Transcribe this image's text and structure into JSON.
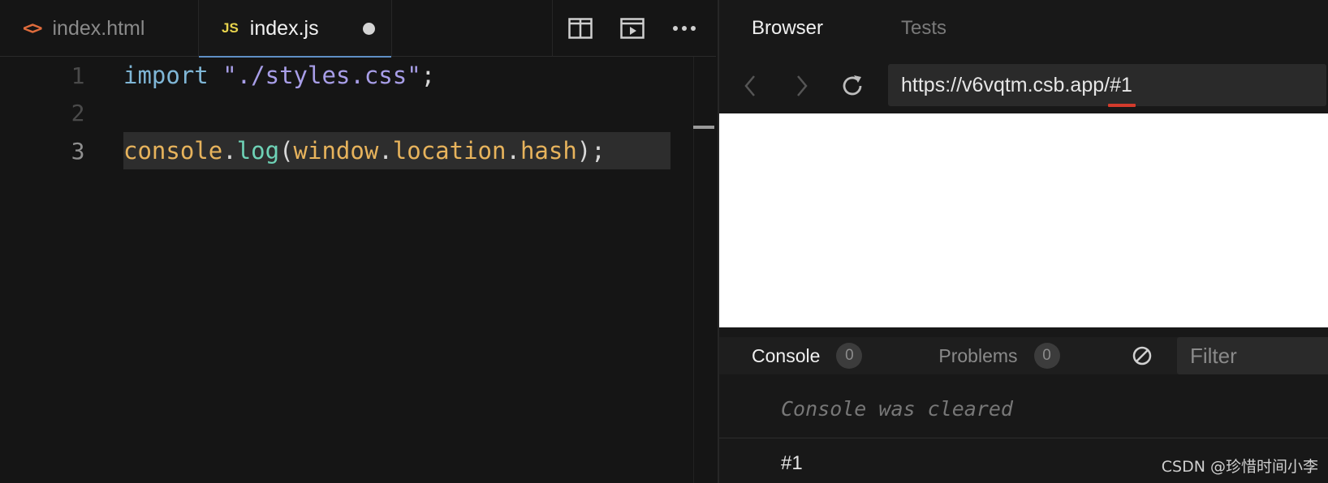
{
  "editor": {
    "tabs": [
      {
        "label": "index.html",
        "icon": "html-code-icon",
        "icon_glyph": "<>",
        "active": false
      },
      {
        "label": "index.js",
        "icon": "js-file-icon",
        "icon_glyph": "JS",
        "active": true,
        "unsaved": true
      }
    ],
    "actions": [
      "split-editor-icon",
      "open-preview-icon",
      "more-actions-icon"
    ],
    "lines": [
      {
        "number": "1",
        "tokens": [
          {
            "t": "import",
            "c": "kw"
          },
          {
            "t": " ",
            "c": "punc"
          },
          {
            "t": "\"./styles.css\"",
            "c": "str"
          },
          {
            "t": ";",
            "c": "punc"
          }
        ]
      },
      {
        "number": "2",
        "tokens": []
      },
      {
        "number": "3",
        "active": true,
        "tokens": [
          {
            "t": "console",
            "c": "ident"
          },
          {
            "t": ".",
            "c": "punc"
          },
          {
            "t": "log",
            "c": "fn"
          },
          {
            "t": "(",
            "c": "punc"
          },
          {
            "t": "window",
            "c": "ident"
          },
          {
            "t": ".",
            "c": "punc"
          },
          {
            "t": "location",
            "c": "ident"
          },
          {
            "t": ".",
            "c": "punc"
          },
          {
            "t": "hash",
            "c": "ident"
          },
          {
            "t": ");",
            "c": "punc"
          }
        ]
      }
    ]
  },
  "browser": {
    "tabs": {
      "browser": "Browser",
      "tests": "Tests"
    },
    "url_base": "https://v6vqtm.csb.app/",
    "url_hash": "#1",
    "highlight_color": "#d33b2c"
  },
  "console": {
    "tab_label": "Console",
    "console_count": "0",
    "problems_label": "Problems",
    "problems_count": "0",
    "filter_placeholder": "Filter",
    "cleared_message": "Console was cleared",
    "output": "#1"
  },
  "watermark": "CSDN @珍惜时间小李"
}
